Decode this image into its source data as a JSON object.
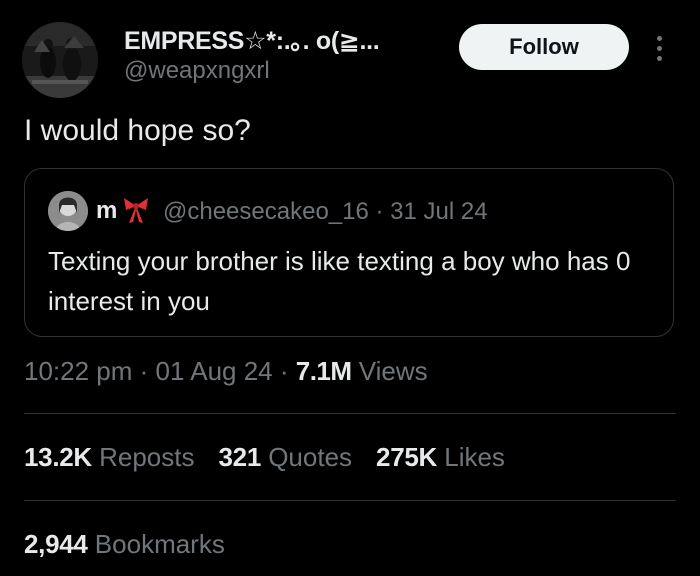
{
  "author": {
    "name": "EMPRESS☆*:.｡. o(≧...",
    "handle": "@weapxngxrl"
  },
  "follow_label": "Follow",
  "tweet_text": "I would hope so?",
  "quote": {
    "name": "m",
    "name_emoji": "ribbon-bow-icon",
    "handle": "@cheesecakeo_16",
    "separator": " · ",
    "date": "31 Jul 24",
    "text": "Texting your brother is like texting a boy who has 0 interest in you"
  },
  "meta": {
    "time": "10:22 pm",
    "separator": " · ",
    "date": "01 Aug 24",
    "views_count": "7.1M",
    "views_label": " Views"
  },
  "stats": {
    "reposts_count": "13.2K",
    "reposts_label": " Reposts",
    "quotes_count": "321",
    "quotes_label": " Quotes",
    "likes_count": "275K",
    "likes_label": " Likes",
    "bookmarks_count": "2,944",
    "bookmarks_label": " Bookmarks"
  },
  "colors": {
    "background": "#000000",
    "text_primary": "#e7e9ea",
    "text_secondary": "#71767b",
    "border": "#2f3336",
    "follow_button_bg": "#eff3f4",
    "bow_red": "#e0303a"
  }
}
